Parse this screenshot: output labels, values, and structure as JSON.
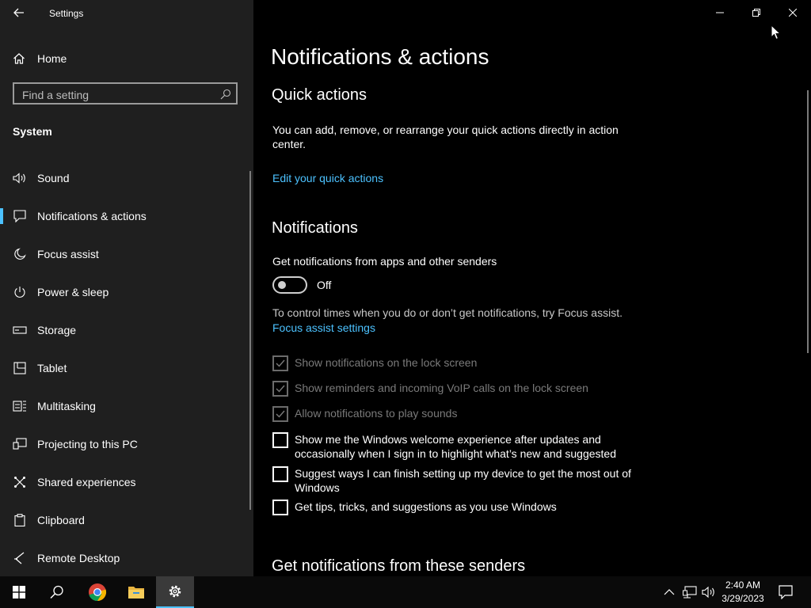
{
  "window": {
    "title": "Settings"
  },
  "sidebar": {
    "home_label": "Home",
    "search_placeholder": "Find a setting",
    "section_title": "System",
    "items": [
      {
        "label": "Sound",
        "icon": "speaker-icon"
      },
      {
        "label": "Notifications & actions",
        "icon": "notification-icon",
        "active": true
      },
      {
        "label": "Focus assist",
        "icon": "moon-icon"
      },
      {
        "label": "Power & sleep",
        "icon": "power-icon"
      },
      {
        "label": "Storage",
        "icon": "storage-icon"
      },
      {
        "label": "Tablet",
        "icon": "tablet-icon"
      },
      {
        "label": "Multitasking",
        "icon": "multitasking-icon"
      },
      {
        "label": "Projecting to this PC",
        "icon": "projector-icon"
      },
      {
        "label": "Shared experiences",
        "icon": "shared-icon"
      },
      {
        "label": "Clipboard",
        "icon": "clipboard-icon"
      },
      {
        "label": "Remote Desktop",
        "icon": "remote-desktop-icon"
      }
    ]
  },
  "main": {
    "page_title": "Notifications & actions",
    "quick_actions": {
      "heading": "Quick actions",
      "description": "You can add, remove, or rearrange your quick actions directly in action center.",
      "link": "Edit your quick actions"
    },
    "notifications": {
      "heading": "Notifications",
      "toggle_label": "Get notifications from apps and other senders",
      "toggle_state": "Off",
      "focus_text": "To control times when you do or don’t get notifications, try Focus assist.",
      "focus_link": "Focus assist settings",
      "checkboxes": [
        {
          "label": "Show notifications on the lock screen",
          "checked": true,
          "disabled": true
        },
        {
          "label": "Show reminders and incoming VoIP calls on the lock screen",
          "checked": true,
          "disabled": true
        },
        {
          "label": "Allow notifications to play sounds",
          "checked": true,
          "disabled": true
        },
        {
          "label": "Show me the Windows welcome experience after updates and occasionally when I sign in to highlight what’s new and suggested",
          "checked": false,
          "disabled": false
        },
        {
          "label": "Suggest ways I can finish setting up my device to get the most out of Windows",
          "checked": false,
          "disabled": false
        },
        {
          "label": "Get tips, tricks, and suggestions as you use Windows",
          "checked": false,
          "disabled": false
        }
      ]
    },
    "senders_heading": "Get notifications from these senders"
  },
  "taskbar": {
    "time": "2:40 AM",
    "date": "3/29/2023",
    "icons": [
      "windows-start-icon",
      "search-icon",
      "chrome-icon",
      "file-explorer-icon",
      "settings-gear-icon"
    ]
  },
  "colors": {
    "accent": "#4cc2ff",
    "sidebar_bg": "#1f1f1f",
    "main_bg": "#000000"
  }
}
